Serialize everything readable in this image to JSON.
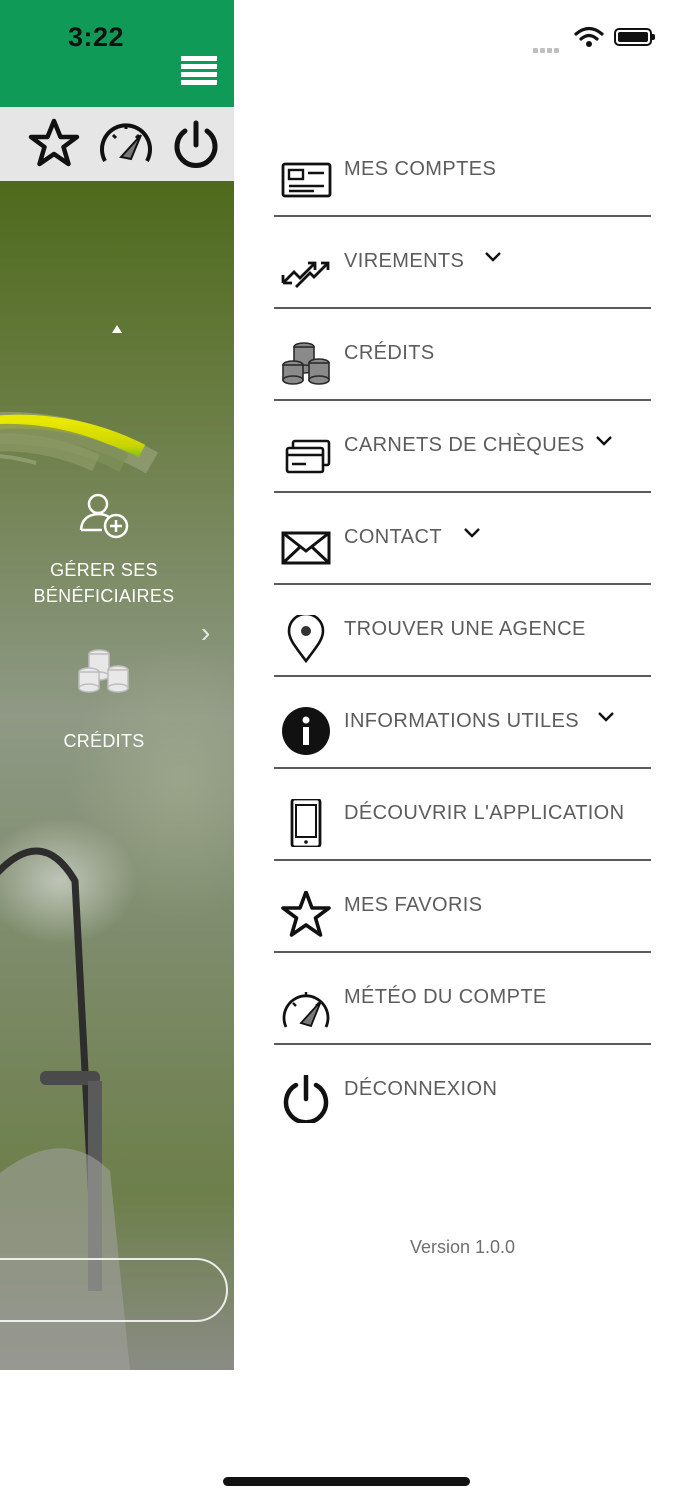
{
  "status_bar": {
    "time": "3:22"
  },
  "left_panel": {
    "toolbar_icons": [
      "star-icon",
      "speedometer-icon",
      "power-icon"
    ],
    "quick_actions": [
      {
        "label": "GÉRER SES BÉNÉFICIAIRES",
        "icon": "add-user-icon"
      },
      {
        "label": "CRÉDITS",
        "icon": "coins-icon"
      }
    ]
  },
  "menu": {
    "items": [
      {
        "label": "MES COMPTES",
        "icon": "id-card-icon",
        "has_submenu": false
      },
      {
        "label": "VIREMENTS",
        "icon": "transfer-arrows-icon",
        "has_submenu": true
      },
      {
        "label": "CRÉDITS",
        "icon": "coins-icon",
        "has_submenu": false
      },
      {
        "label": "CARNETS DE CHÈQUES",
        "icon": "checkbook-icon",
        "has_submenu": true
      },
      {
        "label": "CONTACT",
        "icon": "envelope-icon",
        "has_submenu": true
      },
      {
        "label": "TROUVER UNE AGENCE",
        "icon": "location-pin-icon",
        "has_submenu": false
      },
      {
        "label": "INFORMATIONS UTILES",
        "icon": "info-icon",
        "has_submenu": true
      },
      {
        "label": "DÉCOUVRIR L'APPLICATION",
        "icon": "smartphone-icon",
        "has_submenu": false
      },
      {
        "label": "MES FAVORIS",
        "icon": "star-icon",
        "has_submenu": false
      },
      {
        "label": "MÉTÉO DU COMPTE",
        "icon": "speedometer-icon",
        "has_submenu": false
      },
      {
        "label": "DÉCONNEXION",
        "icon": "power-icon",
        "has_submenu": false
      }
    ]
  },
  "version": "Version 1.0.0",
  "colors": {
    "brand_green": "#0f9a57",
    "menu_text": "#5c5c5c",
    "divider": "#5a5a5a"
  }
}
